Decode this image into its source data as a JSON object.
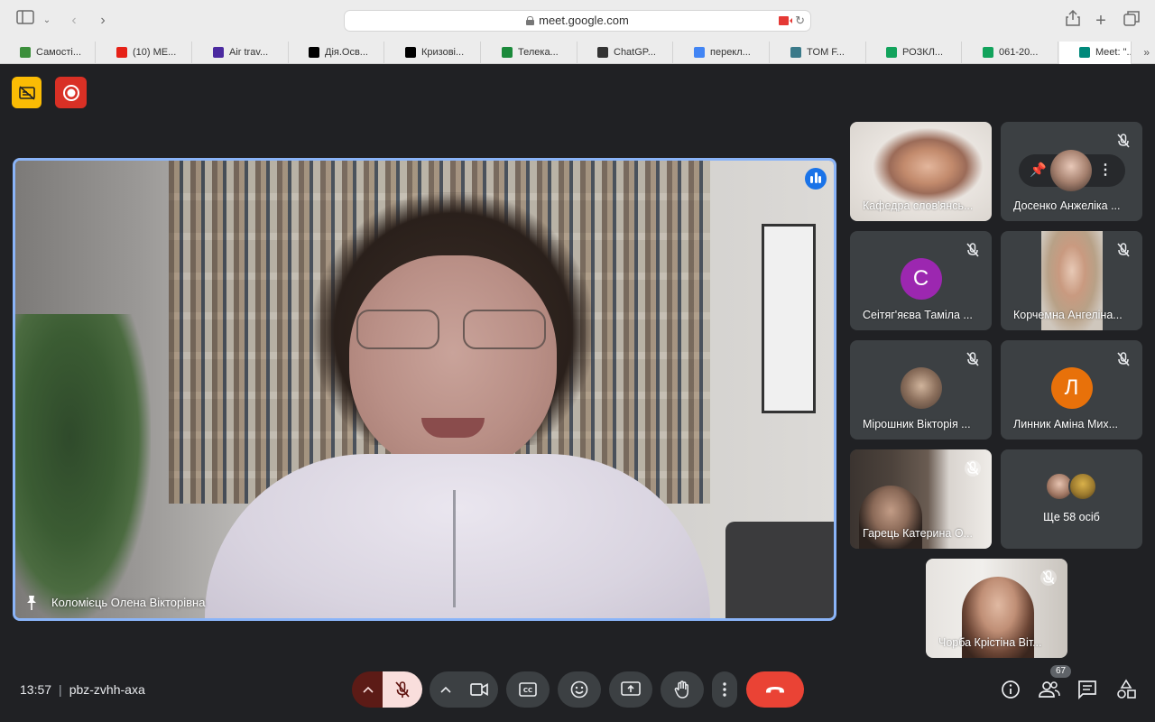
{
  "browser": {
    "url": "meet.google.com",
    "bookmarks": [
      {
        "label": "Самості...",
        "color": "#3c8f3c"
      },
      {
        "label": "(10) ME...",
        "color": "#e62117"
      },
      {
        "label": "Air trav...",
        "color": "#4b2aa0"
      },
      {
        "label": "Дія.Осв...",
        "color": "#000000"
      },
      {
        "label": "Кризові...",
        "color": "#000000"
      },
      {
        "label": "Телека...",
        "color": "#1b8a3b"
      },
      {
        "label": "ChatGP...",
        "color": "#333333"
      },
      {
        "label": "перекл...",
        "color": "#4285f4"
      },
      {
        "label": "TOM F...",
        "color": "#3b7a8a"
      },
      {
        "label": "РОЗКЛ...",
        "color": "#12a35c"
      },
      {
        "label": "061-20...",
        "color": "#12a35c"
      },
      {
        "label": "Meet: \"...",
        "color": "#00897b"
      }
    ]
  },
  "main_speaker": {
    "name": "Коломієць Олена Вікторівна"
  },
  "participants": [
    {
      "name": "Кафедра слов'янсь..."
    },
    {
      "name": "Досенко Анжеліка ..."
    },
    {
      "name": "Сеітяг'яєва Таміла ...",
      "initial": "С",
      "color": "#9c27b0"
    },
    {
      "name": "Корчемна Ангеліна..."
    },
    {
      "name": "Мірошник Вікторія ..."
    },
    {
      "name": "Линник Аміна Мих...",
      "initial": "Л",
      "color": "#e8710a"
    },
    {
      "name": "Гарець Катерина О..."
    },
    {
      "name": "Чорба Крістіна Віт..."
    }
  ],
  "others": {
    "text": "Ще 58 осіб"
  },
  "meeting": {
    "time": "13:57",
    "code": "pbz-zvhh-axa",
    "participant_count": "67"
  }
}
